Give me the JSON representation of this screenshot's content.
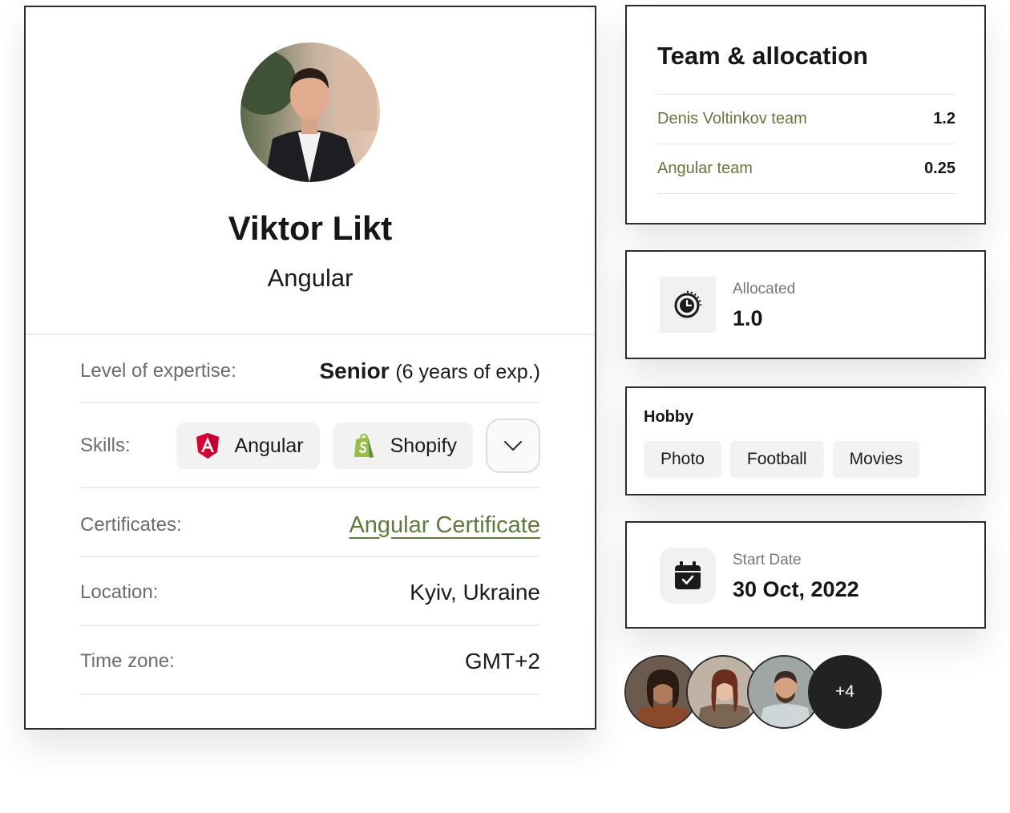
{
  "profile": {
    "name": "Viktor Likt",
    "role": "Angular",
    "expertise_label": "Level of expertise:",
    "expertise_level": "Senior",
    "expertise_years": "(6 years of exp.)",
    "skills_label": "Skills:",
    "skills": [
      {
        "name": "Angular",
        "icon": "angular-icon",
        "color": "#dd0031"
      },
      {
        "name": "Shopify",
        "icon": "shopify-icon",
        "color": "#95bf47"
      }
    ],
    "certificates_label": "Certificates:",
    "certificate": "Angular Certificate",
    "location_label": "Location:",
    "location": "Kyiv, Ukraine",
    "timezone_label": "Time zone:",
    "timezone": "GMT+2"
  },
  "team": {
    "title": "Team & allocation",
    "rows": [
      {
        "name": "Denis Voltinkov team",
        "value": "1.2"
      },
      {
        "name": "Angular team",
        "value": "0.25"
      }
    ]
  },
  "allocated": {
    "label": "Allocated",
    "value": "1.0",
    "icon": "clock-icon"
  },
  "hobby": {
    "title": "Hobby",
    "tags": [
      "Photo",
      "Football",
      "Movies"
    ]
  },
  "start_date": {
    "label": "Start Date",
    "value": "30 Oct, 2022",
    "icon": "calendar-icon"
  },
  "members": {
    "more": "+4"
  },
  "colors": {
    "accent_green": "#5f7a3a",
    "border": "#2b2b2b",
    "chip_bg": "#f2f2f0",
    "dark": "#222222"
  }
}
